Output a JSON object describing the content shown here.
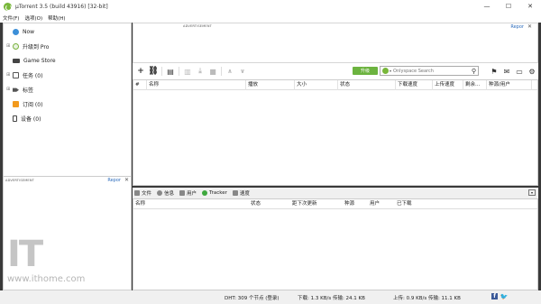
{
  "window": {
    "title": "µTorrent 3.5  (build 43916) [32-bit]",
    "controls": [
      "—",
      "☐",
      "✕"
    ]
  },
  "menu": [
    "文件(F)",
    "选项(O)",
    "帮助(H)"
  ],
  "sidebar": {
    "items": [
      {
        "label": "Now",
        "icon": "now-icon"
      },
      {
        "label": "升级到 Pro",
        "icon": "pro-icon"
      },
      {
        "label": "Game Store",
        "icon": "game-store-icon"
      },
      {
        "label": "任务 (0)",
        "icon": "tasks-icon"
      },
      {
        "label": "标签",
        "icon": "tag-icon"
      },
      {
        "label": "订阅 (0)",
        "icon": "rss-icon"
      },
      {
        "label": "设备 (0)",
        "icon": "device-icon"
      }
    ],
    "ad_label": "ADVERTISEMENT",
    "report": "Repor"
  },
  "top_ad": {
    "ad_label": "ADVERTISEMENT",
    "report": "Repor"
  },
  "toolbar": {
    "upgrade": "升级",
    "search_placeholder": "Onlyspace Search"
  },
  "list_columns": [
    "#",
    "名称",
    "播放",
    "大小",
    "状态",
    "下载速度",
    "上传速度",
    "剩余...",
    "种源/用户"
  ],
  "detail_tabs": [
    "文件",
    "信息",
    "用户",
    "Tracker",
    "速度"
  ],
  "peer_columns": [
    "名称",
    "状态",
    "距下次更新",
    "种源",
    "用户",
    "已下载"
  ],
  "status": {
    "dht": "DHT: 309 个节点 (登录)",
    "download": "下载: 1.3 KB/s 传输: 24.1 KB",
    "upload": "上传: 0.9 KB/s 传输: 11.1 KB"
  },
  "watermark": {
    "logo": "IT之家",
    "url": "www.ithome.com"
  }
}
